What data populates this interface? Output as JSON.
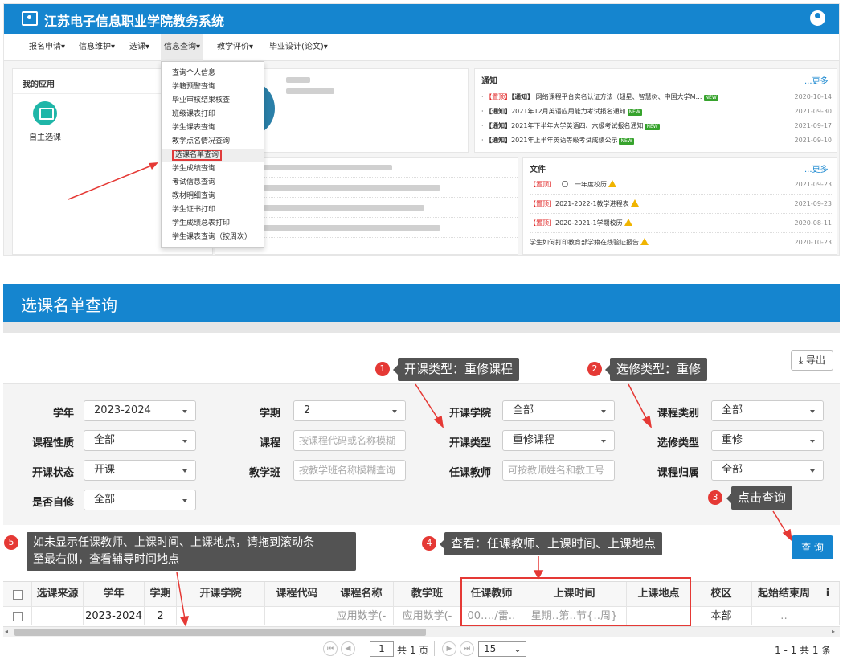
{
  "top": {
    "system_title": "江苏电子信息职业学院教务系统",
    "menu": [
      "报名申请▾",
      "信息维护▾",
      "选课▾",
      "信息查询▾",
      "教学评价▾",
      "毕业设计(论文)▾"
    ],
    "my_apps": "我的应用",
    "app_label": "自主选课",
    "dropdown": [
      "查询个人信息",
      "学籍预警查询",
      "毕业审核结果核查",
      "班级课表打印",
      "学生课表查询",
      "教学点名情况查询",
      "选课名单查询",
      "学生成绩查询",
      "考试信息查询",
      "教材明细查询",
      "学生证书打印",
      "学生成绩总表打印",
      "学生课表查询（按周次）"
    ],
    "notice": {
      "title": "通知",
      "more": "...更多",
      "items": [
        {
          "tag": "【置顶】",
          "tag2": "【通知】",
          "text": "网络课程平台实名认证方法（超星、智慧树、中国大学M…",
          "date": "2020-10-14"
        },
        {
          "tag": "",
          "tag2": "【通知】",
          "text": "2021年12月英语应用能力考试报名通知",
          "date": "2021-09-30"
        },
        {
          "tag": "",
          "tag2": "【通知】",
          "text": "2021年下半年大学英语四、六级考试报名通知",
          "date": "2021-09-17"
        },
        {
          "tag": "",
          "tag2": "【通知】",
          "text": "2021年上半年英语等级考试成绩公示",
          "date": "2021-09-10"
        }
      ],
      "new_badge": "NEW"
    },
    "files": {
      "title": "文件",
      "more": "...更多",
      "items": [
        {
          "tag": "【置顶】",
          "text": "二〇二一年度校历",
          "date": "2021-09-23"
        },
        {
          "tag": "【置顶】",
          "text": "2021-2022-1教学进程表",
          "date": "2021-09-23"
        },
        {
          "tag": "【置顶】",
          "text": "2020-2021-1学期校历",
          "date": "2020-08-11"
        },
        {
          "tag": "",
          "text": "学生如何打印教育部学籍在线验证报告",
          "date": "2020-10-23"
        }
      ]
    }
  },
  "page": {
    "title": "选课名单查询",
    "export": "导出",
    "query": "查 询"
  },
  "form": {
    "xn": {
      "label": "学年",
      "value": "2023-2024"
    },
    "xq": {
      "label": "学期",
      "value": "2"
    },
    "kkxy": {
      "label": "开课学院",
      "value": "全部"
    },
    "kclb": {
      "label": "课程类别",
      "value": "全部"
    },
    "kcxz": {
      "label": "课程性质",
      "value": "全部"
    },
    "kc": {
      "label": "课程",
      "placeholder": "按课程代码或名称模糊"
    },
    "kklx": {
      "label": "开课类型",
      "value": "重修课程"
    },
    "xxlx": {
      "label": "选修类型",
      "value": "重修"
    },
    "kkzt": {
      "label": "开课状态",
      "value": "开课"
    },
    "jxb": {
      "label": "教学班",
      "placeholder": "按教学班名称模糊查询"
    },
    "rkjs": {
      "label": "任课教师",
      "placeholder": "可按教师姓名和教工号"
    },
    "kcgs": {
      "label": "课程归属",
      "value": "全部"
    },
    "sfzx": {
      "label": "是否自修",
      "value": "全部"
    }
  },
  "callouts": {
    "c1": {
      "num": "1",
      "text": "开课类型：重修课程"
    },
    "c2": {
      "num": "2",
      "text": "选修类型：重修"
    },
    "c3": {
      "num": "3",
      "text": "点击查询"
    },
    "c4": {
      "num": "4",
      "text": "查看：任课教师、上课时间、上课地点"
    },
    "c5": {
      "num": "5",
      "line1": "如未显示任课教师、上课时间、上课地点，请拖到滚动条",
      "line2": "至最右侧，查看辅导时间地点"
    }
  },
  "table": {
    "headers": [
      "选课来源",
      "学年",
      "学期",
      "开课学院",
      "课程代码",
      "课程名称",
      "教学班",
      "任课教师",
      "上课时间",
      "上课地点",
      "校区",
      "起始结束周",
      "i"
    ],
    "row": [
      "",
      "2023-2024",
      "2",
      "",
      "",
      "应用数学(-",
      "应用数学(-",
      "00‥‥/雷‥",
      "星期‥第‥节{‥周}",
      "",
      "本部",
      "‥",
      ""
    ]
  },
  "pager": {
    "page_input": "1",
    "total_pages": "共 1 页",
    "page_size": "15",
    "summary": "1 - 1  共 1 条"
  },
  "colors": {
    "primary": "#1585cf",
    "callout": "#535353",
    "highlight": "#e53935"
  }
}
